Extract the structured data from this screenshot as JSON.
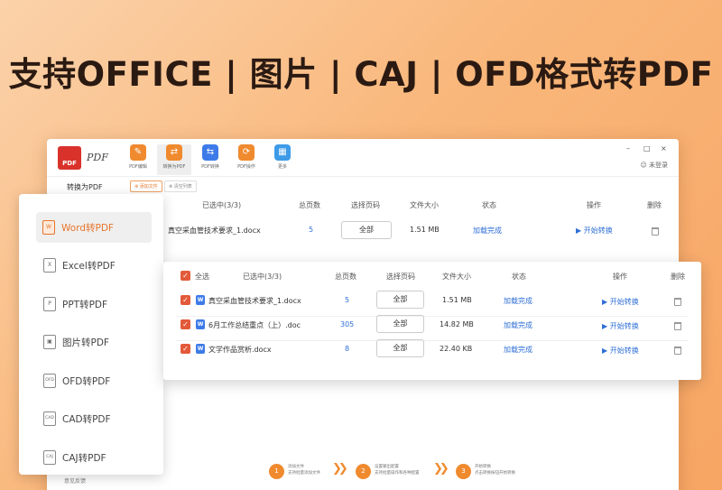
{
  "banner": "支持OFFICE | 图片 | CAJ | OFD格式转PDF",
  "app": {
    "logo_text": "PDF",
    "logo_title": "PDF",
    "login": "未登录",
    "window_controls": [
      "–",
      "□",
      "×"
    ]
  },
  "toolbar": [
    {
      "label": "PDF编辑",
      "color": "#f08a2e",
      "icon": "edit-icon"
    },
    {
      "label": "转换为PDF",
      "color": "#f08a2e",
      "icon": "convert-icon"
    },
    {
      "label": "PDF转换",
      "color": "#3d7be8",
      "icon": "pdf-convert-icon"
    },
    {
      "label": "PDF操作",
      "color": "#f08a2e",
      "icon": "pdf-operate-icon"
    },
    {
      "label": "更多",
      "color": "#3d9be8",
      "icon": "grid-icon"
    }
  ],
  "sub_toolbar": {
    "side_title": "转换为PDF",
    "add_file": "添加文件",
    "clear_list": "清空列表"
  },
  "bg_table": {
    "selected": "已选中(3/3)",
    "headers": [
      "总页数",
      "选择页码",
      "文件大小",
      "状态",
      "操作",
      "删除"
    ],
    "row": {
      "name": "真空采血管技术要求_1.docx",
      "pages": "5",
      "range": "全部",
      "size": "1.51 MB",
      "status": "加载完成",
      "action": "开始转换"
    }
  },
  "sidebar": {
    "items": [
      {
        "label": "Word转PDF",
        "icon": "W"
      },
      {
        "label": "Excel转PDF",
        "icon": "X"
      },
      {
        "label": "PPT转PDF",
        "icon": "P"
      },
      {
        "label": "图片转PDF",
        "icon": "▣"
      },
      {
        "label": "OFD转PDF",
        "icon": "OFD"
      },
      {
        "label": "CAD转PDF",
        "icon": "CAD"
      },
      {
        "label": "CAJ转PDF",
        "icon": "CAJ"
      }
    ],
    "feedback": "意见反馈"
  },
  "popup": {
    "select_all": "全选",
    "selected": "已选中(3/3)",
    "headers": [
      "总页数",
      "选择页码",
      "文件大小",
      "状态",
      "操作",
      "删除"
    ],
    "rows": [
      {
        "name": "真空采血管技术要求_1.docx",
        "pages": "5",
        "range": "全部",
        "size": "1.51 MB",
        "status": "加载完成",
        "action": "开始转换"
      },
      {
        "name": "6月工作总结重点（上）.doc",
        "pages": "305",
        "range": "全部",
        "size": "14.82 MB",
        "status": "加载完成",
        "action": "开始转换"
      },
      {
        "name": "文学作品赏析.docx",
        "pages": "8",
        "range": "全部",
        "size": "22.40 KB",
        "status": "加载完成",
        "action": "开始转换"
      }
    ]
  },
  "steps": [
    {
      "num": "1",
      "line1": "添加文件",
      "line2": "支持批量添加文件"
    },
    {
      "num": "2",
      "line1": "设置输出配置",
      "line2": "支持批量操作和各种配置"
    },
    {
      "num": "3",
      "line1": "开始转换",
      "line2": "点击转换按钮开始转换"
    }
  ],
  "colors": {
    "accent": "#f08a2e",
    "link": "#2f6fd6",
    "check": "#e35a3a"
  }
}
